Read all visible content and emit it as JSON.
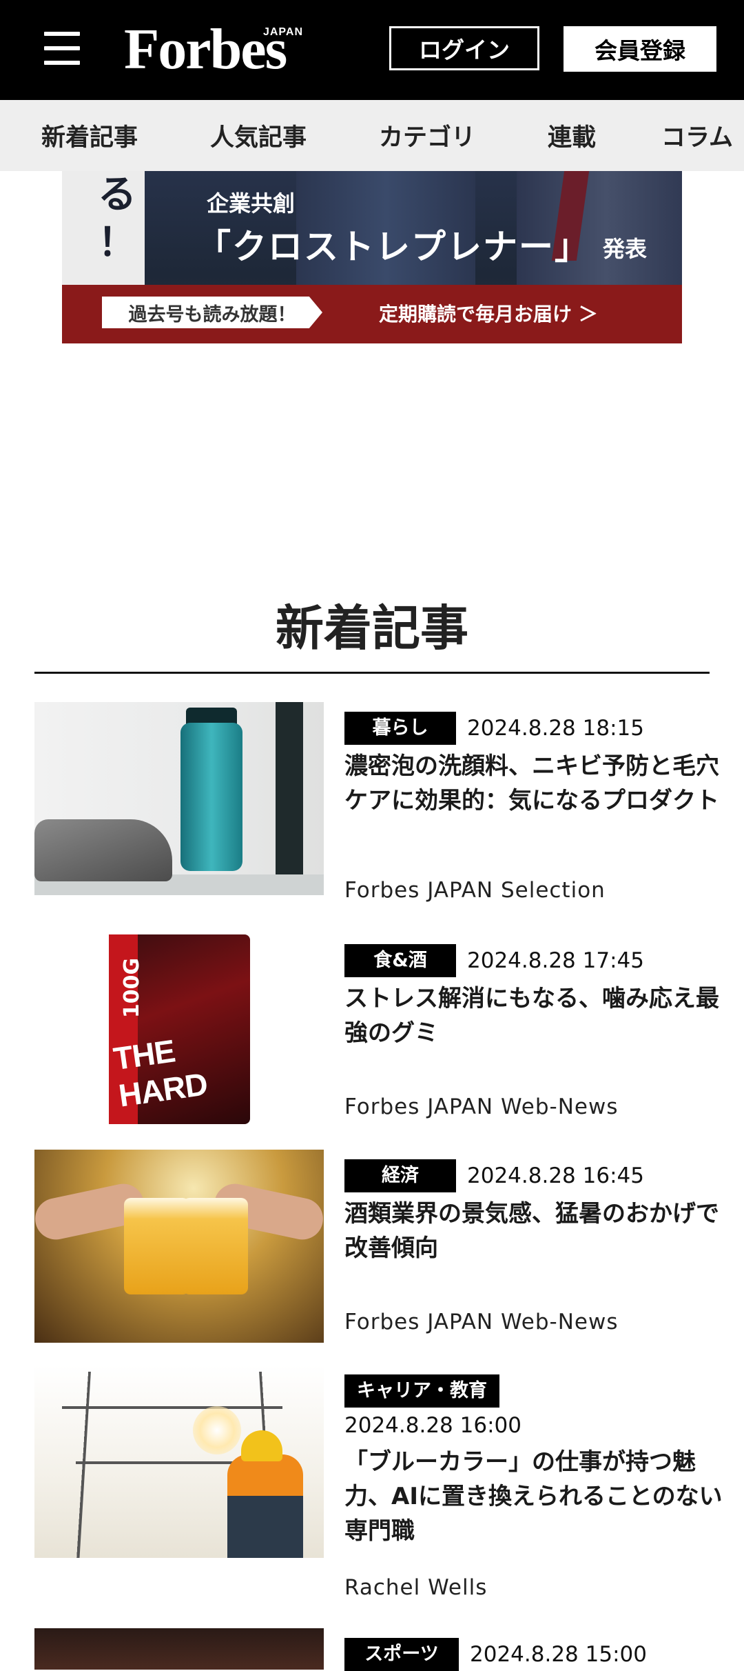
{
  "header": {
    "logo_text": "Forbes",
    "logo_sub": "JAPAN",
    "login_label": "ログイン",
    "register_label": "会員登録"
  },
  "nav": {
    "tabs": [
      {
        "label": "新着記事"
      },
      {
        "label": "人気記事"
      },
      {
        "label": "カテゴリ"
      },
      {
        "label": "連載"
      },
      {
        "label": "コラム"
      }
    ]
  },
  "banner": {
    "left_text": "る\n！",
    "kicker": "企業共創",
    "headline": "「クロストレプレナー」",
    "tail": "発表",
    "pill": "過去号も読み放題！",
    "cta": "定期購読で毎月お届け ＞"
  },
  "section": {
    "title": "新着記事"
  },
  "articles": [
    {
      "category": "暮らし",
      "date": "2024.8.28 18:15",
      "title": "濃密泡の洗顔料、ニキビ予防と毛穴ケアに効果的：気になるプロダクト",
      "author": "Forbes JAPAN Selection"
    },
    {
      "category": "食&酒",
      "date": "2024.8.28 17:45",
      "title": "ストレス解消にもなる、噛み応え最強のグミ",
      "author": "Forbes JAPAN Web-News"
    },
    {
      "category": "経済",
      "date": "2024.8.28 16:45",
      "title": "酒類業界の景気感、猛暑のおかげで改善傾向",
      "author": "Forbes JAPAN Web-News"
    },
    {
      "category": "キャリア・教育",
      "date": "2024.8.28 16:00",
      "title": "「ブルーカラー」の仕事が持つ魅力、AIに置き換えられることのない専門職",
      "author": "Rachel Wells"
    },
    {
      "category": "スポーツ",
      "date": "2024.8.28 15:00"
    }
  ],
  "thumb_text": {
    "gummy": "THE HARD",
    "gummy_weight": "100G"
  }
}
